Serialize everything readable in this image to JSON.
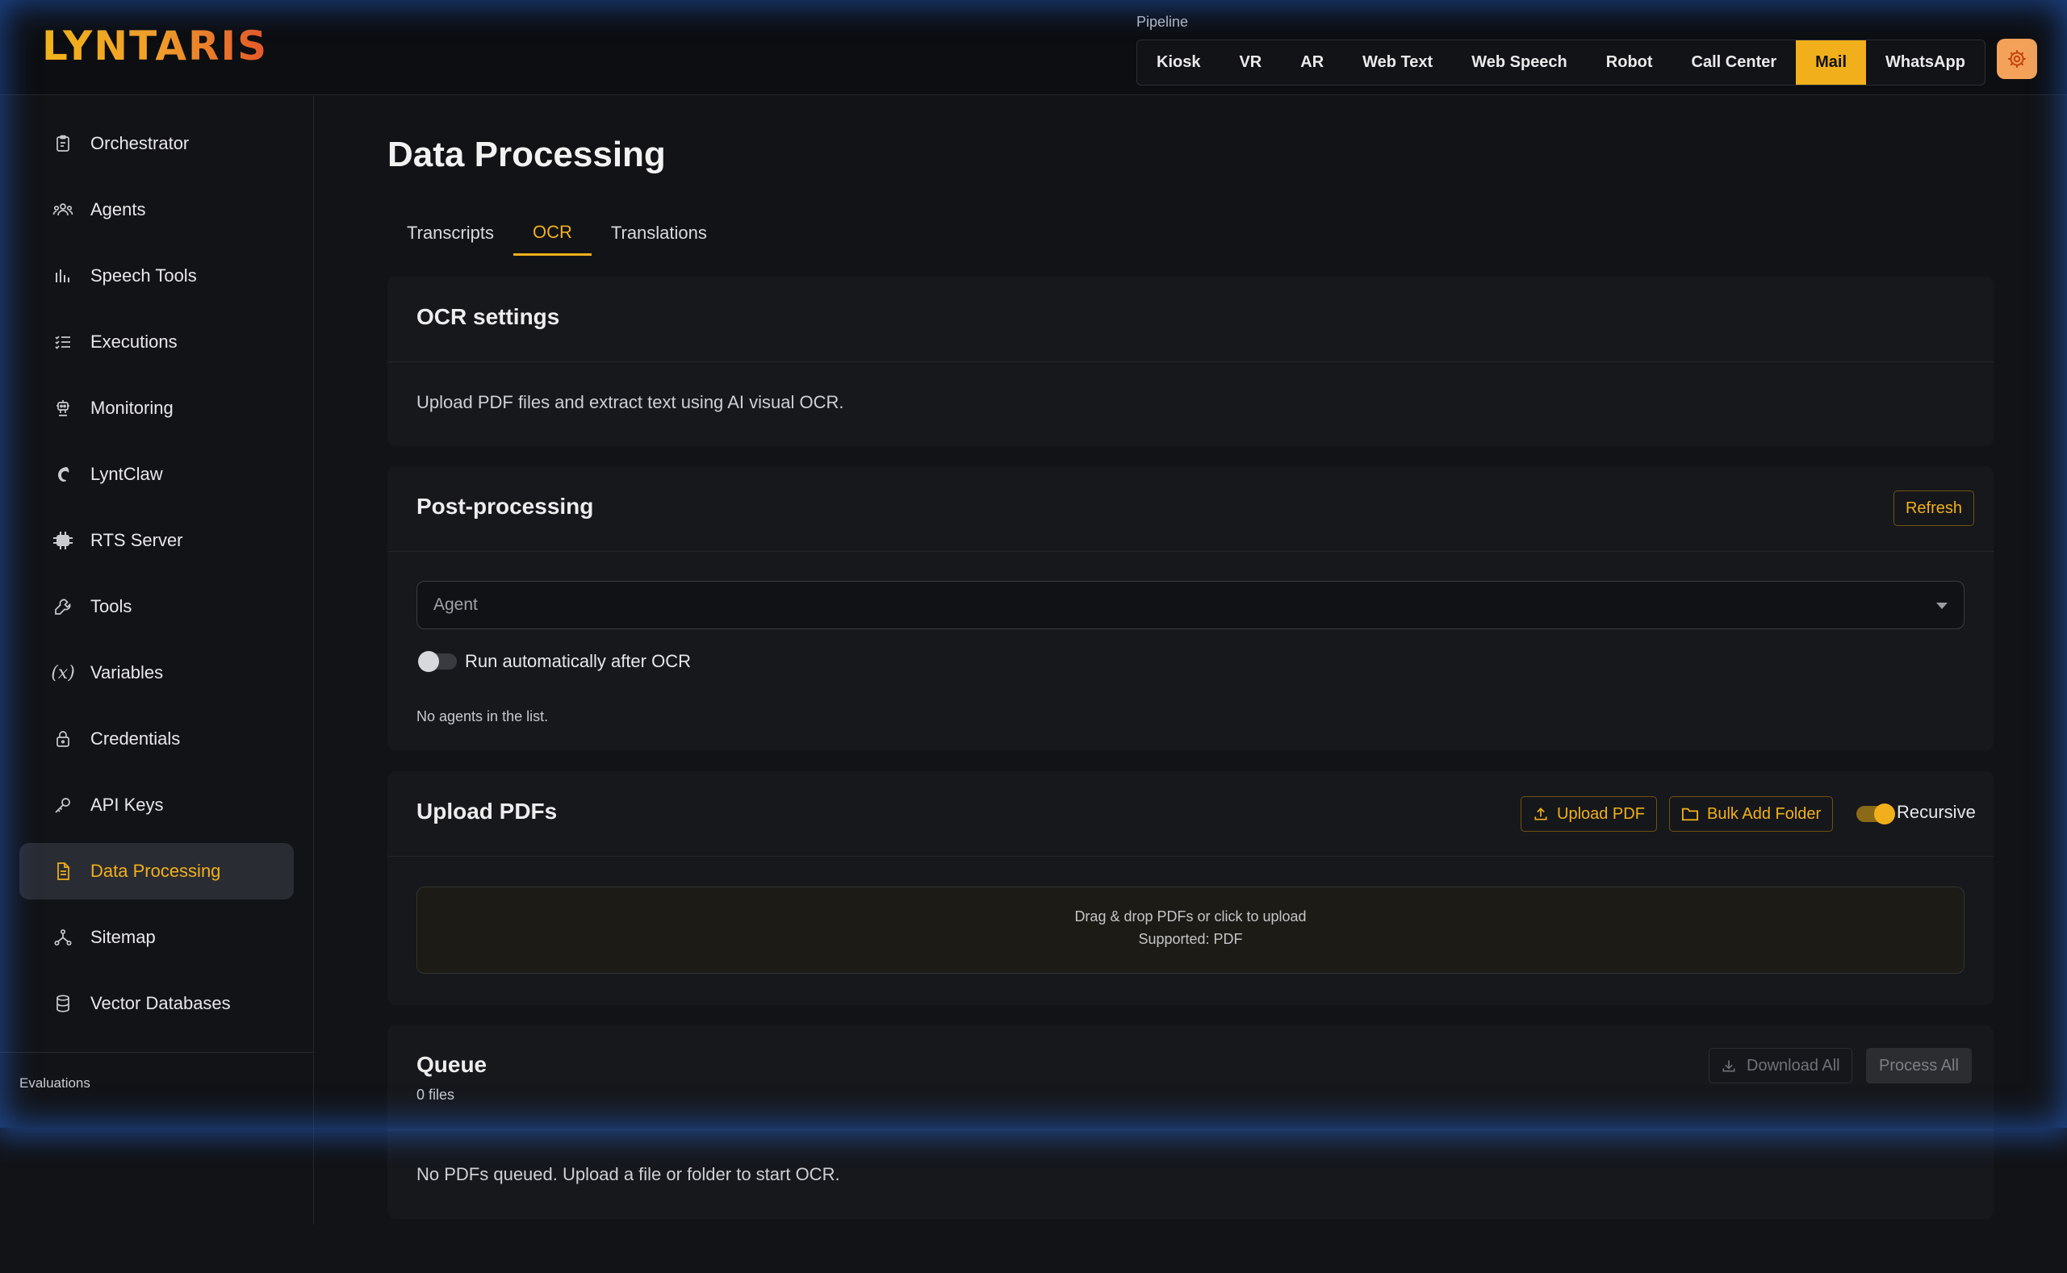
{
  "app": {
    "logo": "LYNTARIS"
  },
  "pipeline": {
    "label": "Pipeline",
    "tabs": [
      "Kiosk",
      "VR",
      "AR",
      "Web Text",
      "Web Speech",
      "Robot",
      "Call Center",
      "Mail",
      "WhatsApp"
    ],
    "active": "Mail"
  },
  "sidebar": {
    "items": [
      {
        "label": "Orchestrator",
        "icon": "clipboard-icon"
      },
      {
        "label": "Agents",
        "icon": "users-icon"
      },
      {
        "label": "Speech Tools",
        "icon": "bars-icon"
      },
      {
        "label": "Executions",
        "icon": "list-check-icon"
      },
      {
        "label": "Monitoring",
        "icon": "robot-icon"
      },
      {
        "label": "LyntClaw",
        "icon": "claw-icon"
      },
      {
        "label": "RTS Server",
        "icon": "server-icon"
      },
      {
        "label": "Tools",
        "icon": "wrench-icon"
      },
      {
        "label": "Variables",
        "icon": "variable-icon"
      },
      {
        "label": "Credentials",
        "icon": "lock-icon"
      },
      {
        "label": "API Keys",
        "icon": "key-icon"
      },
      {
        "label": "Data Processing",
        "icon": "document-icon"
      },
      {
        "label": "Sitemap",
        "icon": "sitemap-icon"
      },
      {
        "label": "Vector Databases",
        "icon": "database-icon"
      }
    ],
    "active": "Data Processing",
    "section_label": "Evaluations"
  },
  "page": {
    "title": "Data Processing",
    "tabs": [
      "Transcripts",
      "OCR",
      "Translations"
    ],
    "active_tab": "OCR"
  },
  "ocr_settings": {
    "title": "OCR settings",
    "description": "Upload PDF files and extract text using AI visual OCR."
  },
  "post_processing": {
    "title": "Post-processing",
    "refresh_label": "Refresh",
    "agent_placeholder": "Agent",
    "auto_run_label": "Run automatically after OCR",
    "auto_run_on": false,
    "empty_note": "No agents in the list."
  },
  "upload": {
    "title": "Upload PDFs",
    "upload_label": "Upload PDF",
    "bulk_label": "Bulk Add Folder",
    "recursive_label": "Recursive",
    "recursive_on": true,
    "drop_line1": "Drag & drop PDFs or click to upload",
    "drop_line2": "Supported: PDF"
  },
  "queue": {
    "title": "Queue",
    "count": "0 files",
    "download_label": "Download All",
    "process_label": "Process All",
    "empty": "No PDFs queued. Upload a file or folder to start OCR."
  },
  "colors": {
    "accent": "#f1b01b",
    "background": "#121316",
    "card": "#17181c",
    "glow": "#2a6ee6"
  }
}
